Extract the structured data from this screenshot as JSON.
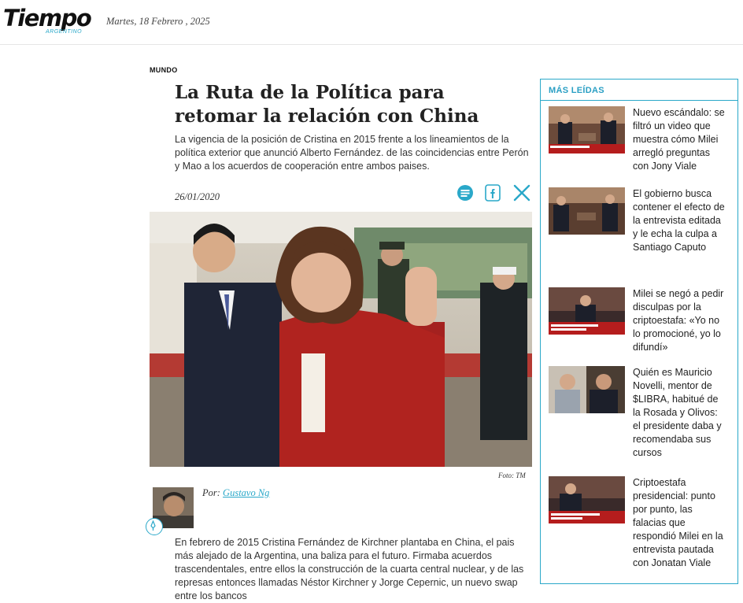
{
  "header": {
    "logo_main": "Tiempo",
    "logo_sub": "ARGENTINO",
    "date": "Martes, 18 Febrero , 2025"
  },
  "article": {
    "section": "MUNDO",
    "title": "La Ruta de la Política para retomar la relación con China",
    "lead": "La vigencia de la posición de Cristina en 2015 frente a los lineamientos de la política exterior que anunció Alberto Fernández. de las coincidencias entre Perón y Mao a los acuerdos de cooperación entre ambos paises.",
    "date": "26/01/2020",
    "photo_credit": "Foto: TM",
    "byline_prefix": "Por:",
    "author": "Gustavo Ng",
    "body": "En febrero de 2015 Cristina Fernández de Kirchner plantaba en China, el pais más alejado de la Argentina, una baliza para el futuro. Firmaba acuerdos trascendentales, entre ellos la construcción de la cuarta central nuclear, y de las represas entonces llamadas Néstor Kirchner y Jorge Cepernic, un nuevo swap entre los bancos"
  },
  "share_icons": [
    "comment-icon",
    "facebook-icon",
    "x-icon"
  ],
  "sidebar": {
    "title": "MÁS LEÍDAS",
    "items": [
      {
        "text": "Nuevo escándalo: se filtró un video que muestra cómo Milei arregló preguntas con Jony Viale"
      },
      {
        "text": "El gobierno busca contener el efecto de la entrevista editada y le echa la culpa a Santiago Caputo"
      },
      {
        "text": "Milei se negó a pedir disculpas por la criptoestafa: «Yo no lo promocioné, yo lo difundí»"
      },
      {
        "text": "Quién es Mauricio Novelli, mentor de $LIBRA, habitué de la Rosada y Olivos: el presidente daba y recomendaba sus cursos"
      },
      {
        "text": "Criptoestafa presidencial: punto por punto, las falacias que respondió Milei en la entrevista pautada con Jonatan Viale"
      }
    ]
  },
  "colors": {
    "accent": "#2aa8c9",
    "text": "#222222"
  }
}
